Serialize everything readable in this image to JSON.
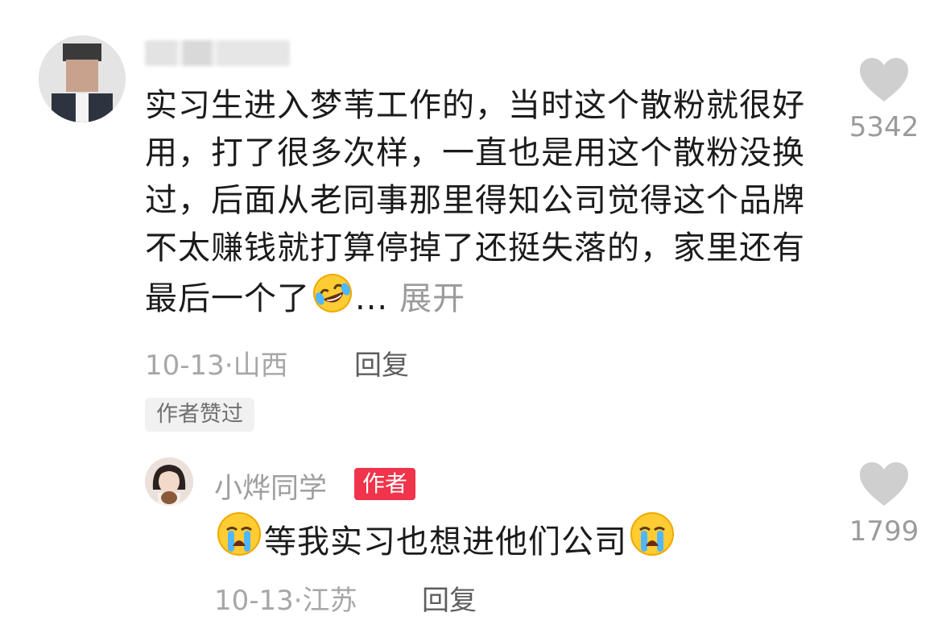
{
  "comment": {
    "text": "实习生进入梦苇工作的，当时这个散粉就很好用，打了很多次样，一直也是用这个散粉没换过，后面从老同事那里得知公司觉得这个品牌不太赚钱就打算停掉了还挺失落的，家里还有最后一个了",
    "ellipsis": "...",
    "expand_label": "展开",
    "date": "10-13",
    "location": "山西",
    "reply_label": "回复",
    "author_liked_badge": "作者赞过",
    "like_count": "5342",
    "emoji": "rolling-on-floor-laughing"
  },
  "reply": {
    "username": "小烨同学",
    "author_badge": "作者",
    "text": "等我实习也想进他们公司",
    "date": "10-13",
    "location": "江苏",
    "reply_label": "回复",
    "like_count": "1799",
    "emoji": "crying-face"
  },
  "colors": {
    "text": "#1b1b1b",
    "muted": "#a7a7a7",
    "author_badge": "#f0344b",
    "heart": "#cfcfcf"
  }
}
